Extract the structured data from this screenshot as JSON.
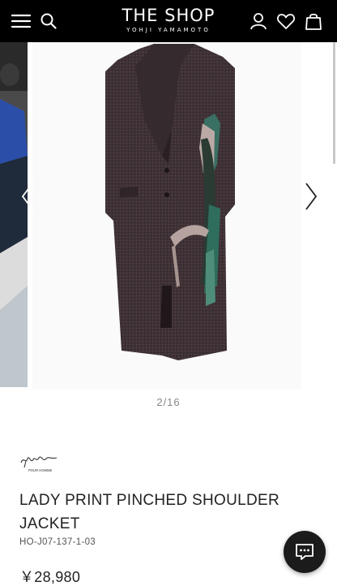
{
  "header": {
    "brand_title": "THE SHOP",
    "brand_subtitle": "YOHJI YAMAMOTO",
    "icons": [
      "menu-icon",
      "search-icon",
      "account-icon",
      "heart-icon",
      "bag-icon"
    ],
    "background": "#000000"
  },
  "gallery": {
    "counter": "2/16",
    "current": 2,
    "total": 16
  },
  "product": {
    "brand_logo_text": "POUR HOMME",
    "title": "LADY PRINT PINCHED SHOULDER JACKET",
    "sku": "HO-J07-137-1-03",
    "price": "￥28,980"
  },
  "chat": {
    "icon": "chat-icon"
  },
  "colors": {
    "header_bg": "#000000",
    "coat": "#3e3134",
    "text": "#222222",
    "muted": "#888888"
  }
}
